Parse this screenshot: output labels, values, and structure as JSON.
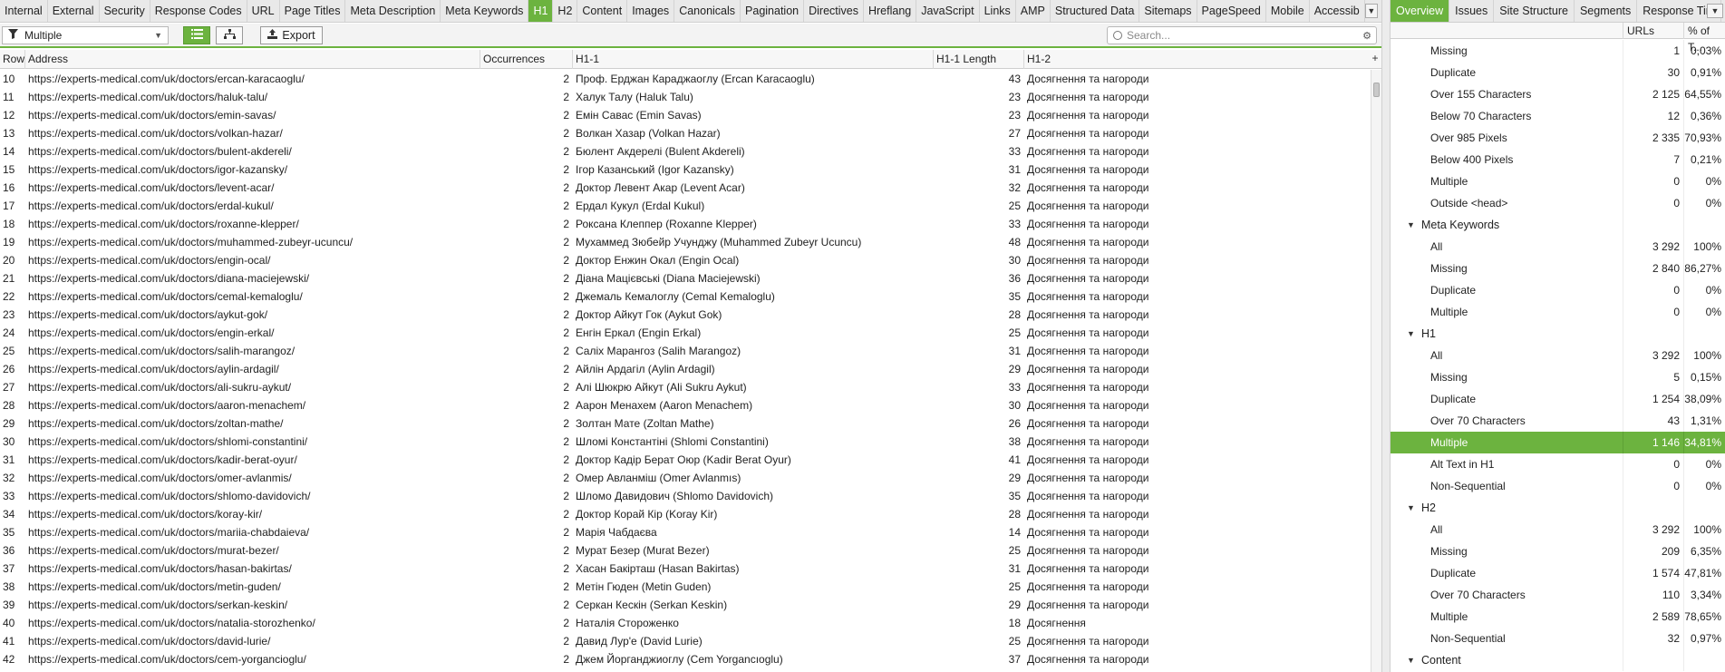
{
  "tabs": [
    "Internal",
    "External",
    "Security",
    "Response Codes",
    "URL",
    "Page Titles",
    "Meta Description",
    "Meta Keywords",
    "H1",
    "H2",
    "Content",
    "Images",
    "Canonicals",
    "Pagination",
    "Directives",
    "Hreflang",
    "JavaScript",
    "Links",
    "AMP",
    "Structured Data",
    "Sitemaps",
    "PageSpeed",
    "Mobile",
    "Accessib"
  ],
  "active_tab": "H1",
  "toolbar": {
    "filter_value": "Multiple",
    "export_label": "Export",
    "search_placeholder": "Search..."
  },
  "columns": {
    "row": "Row",
    "address": "Address",
    "occurrences": "Occurrences",
    "h1_1": "H1-1",
    "h1_1_length": "H1-1 Length",
    "h1_2": "H1-2"
  },
  "rows": [
    {
      "row": "10",
      "address": "https://experts-medical.com/uk/doctors/ercan-karacaoglu/",
      "occ": "2",
      "h1": "Проф. Ерджан Караджаоглу (Ercan Karacaoglu)",
      "len": "43",
      "h12": "Досягнення та нагороди"
    },
    {
      "row": "11",
      "address": "https://experts-medical.com/uk/doctors/haluk-talu/",
      "occ": "2",
      "h1": "Халук Талу (Haluk Talu)",
      "len": "23",
      "h12": "Досягнення та нагороди"
    },
    {
      "row": "12",
      "address": "https://experts-medical.com/uk/doctors/emin-savas/",
      "occ": "2",
      "h1": "Емін Савас (Emin Savas)",
      "len": "23",
      "h12": "Досягнення та нагороди"
    },
    {
      "row": "13",
      "address": "https://experts-medical.com/uk/doctors/volkan-hazar/",
      "occ": "2",
      "h1": "Волкан Хазар (Volkan Hazar)",
      "len": "27",
      "h12": "Досягнення та нагороди"
    },
    {
      "row": "14",
      "address": "https://experts-medical.com/uk/doctors/bulent-akdereli/",
      "occ": "2",
      "h1": "Бюлент Акдерелі (Bulent Akdereli)",
      "len": "33",
      "h12": "Досягнення та нагороди"
    },
    {
      "row": "15",
      "address": "https://experts-medical.com/uk/doctors/igor-kazansky/",
      "occ": "2",
      "h1": "Ігор Казанський (Igor Kazansky)",
      "len": "31",
      "h12": "Досягнення та нагороди"
    },
    {
      "row": "16",
      "address": "https://experts-medical.com/uk/doctors/levent-acar/",
      "occ": "2",
      "h1": "Доктор Левент Акар (Levent Acar)",
      "len": "32",
      "h12": "Досягнення та нагороди"
    },
    {
      "row": "17",
      "address": "https://experts-medical.com/uk/doctors/erdal-kukul/",
      "occ": "2",
      "h1": "Ердал Кукул (Erdal Kukul)",
      "len": "25",
      "h12": "Досягнення та нагороди"
    },
    {
      "row": "18",
      "address": "https://experts-medical.com/uk/doctors/roxanne-klepper/",
      "occ": "2",
      "h1": "Роксана Клеппер (Roxanne Klepper)",
      "len": "33",
      "h12": "Досягнення та нагороди"
    },
    {
      "row": "19",
      "address": "https://experts-medical.com/uk/doctors/muhammed-zubeyr-ucuncu/",
      "occ": "2",
      "h1": "Мухаммед Зюбейр Учунджу (Muhammed Zubeyr Ucuncu)",
      "len": "48",
      "h12": "Досягнення та нагороди"
    },
    {
      "row": "20",
      "address": "https://experts-medical.com/uk/doctors/engin-ocal/",
      "occ": "2",
      "h1": "Доктор Енжин Окал (Engin Ocal)",
      "len": "30",
      "h12": "Досягнення та нагороди"
    },
    {
      "row": "21",
      "address": "https://experts-medical.com/uk/doctors/diana-maciejewski/",
      "occ": "2",
      "h1": "Діана Мацієвські (Diana Maciejewski)",
      "len": "36",
      "h12": "Досягнення та нагороди"
    },
    {
      "row": "22",
      "address": "https://experts-medical.com/uk/doctors/cemal-kemaloglu/",
      "occ": "2",
      "h1": "Джемаль Кемалоглу (Cemal Kemaloglu)",
      "len": "35",
      "h12": "Досягнення та нагороди"
    },
    {
      "row": "23",
      "address": "https://experts-medical.com/uk/doctors/aykut-gok/",
      "occ": "2",
      "h1": "Доктор Айкут Гок (Aykut Gok)",
      "len": "28",
      "h12": "Досягнення та нагороди"
    },
    {
      "row": "24",
      "address": "https://experts-medical.com/uk/doctors/engin-erkal/",
      "occ": "2",
      "h1": "Енгін Еркал (Engin Erkal)",
      "len": "25",
      "h12": "Досягнення та нагороди"
    },
    {
      "row": "25",
      "address": "https://experts-medical.com/uk/doctors/salih-marangoz/",
      "occ": "2",
      "h1": "Саліх Марангоз (Salih Marangoz)",
      "len": "31",
      "h12": "Досягнення та нагороди"
    },
    {
      "row": "26",
      "address": "https://experts-medical.com/uk/doctors/aylin-ardagil/",
      "occ": "2",
      "h1": "Айлін Ардагіл (Aylin Ardagil)",
      "len": "29",
      "h12": "Досягнення та нагороди"
    },
    {
      "row": "27",
      "address": "https://experts-medical.com/uk/doctors/ali-sukru-aykut/",
      "occ": "2",
      "h1": "Алі Шюкрю Айкут (Ali Sukru Aykut)",
      "len": "33",
      "h12": "Досягнення та нагороди"
    },
    {
      "row": "28",
      "address": "https://experts-medical.com/uk/doctors/aaron-menachem/",
      "occ": "2",
      "h1": "Аарон Менахем (Aaron Menachem)",
      "len": "30",
      "h12": "Досягнення та нагороди"
    },
    {
      "row": "29",
      "address": "https://experts-medical.com/uk/doctors/zoltan-mathe/",
      "occ": "2",
      "h1": "Золтан Мате (Zoltan Mathe)",
      "len": "26",
      "h12": "Досягнення та нагороди"
    },
    {
      "row": "30",
      "address": "https://experts-medical.com/uk/doctors/shlomi-constantini/",
      "occ": "2",
      "h1": "Шломі Константіні (Shlomi Constantini)",
      "len": "38",
      "h12": "Досягнення та нагороди"
    },
    {
      "row": "31",
      "address": "https://experts-medical.com/uk/doctors/kadir-berat-oyur/",
      "occ": "2",
      "h1": "Доктор Кадір Берат Оюр (Kadir Berat Oyur)",
      "len": "41",
      "h12": "Досягнення та нагороди"
    },
    {
      "row": "32",
      "address": "https://experts-medical.com/uk/doctors/omer-avlanmis/",
      "occ": "2",
      "h1": "Омер Авланміш (Omer Avlanmıs)",
      "len": "29",
      "h12": "Досягнення та нагороди"
    },
    {
      "row": "33",
      "address": "https://experts-medical.com/uk/doctors/shlomo-davidovich/",
      "occ": "2",
      "h1": "Шломо Давидович (Shlomo Davidovich)",
      "len": "35",
      "h12": "Досягнення та нагороди"
    },
    {
      "row": "34",
      "address": "https://experts-medical.com/uk/doctors/koray-kir/",
      "occ": "2",
      "h1": "Доктор Корай Кір (Koray Kir)",
      "len": "28",
      "h12": "Досягнення та нагороди"
    },
    {
      "row": "35",
      "address": "https://experts-medical.com/uk/doctors/mariia-chabdaieva/",
      "occ": "2",
      "h1": "Марія Чабдаєва",
      "len": "14",
      "h12": "Досягнення та нагороди"
    },
    {
      "row": "36",
      "address": "https://experts-medical.com/uk/doctors/murat-bezer/",
      "occ": "2",
      "h1": "Мурат Безер (Murat Bezer)",
      "len": "25",
      "h12": "Досягнення та нагороди"
    },
    {
      "row": "37",
      "address": "https://experts-medical.com/uk/doctors/hasan-bakirtas/",
      "occ": "2",
      "h1": "Хасан Бакірташ (Hasan Bakirtas)",
      "len": "31",
      "h12": "Досягнення та нагороди"
    },
    {
      "row": "38",
      "address": "https://experts-medical.com/uk/doctors/metin-guden/",
      "occ": "2",
      "h1": "Метін Гюден (Metin Guden)",
      "len": "25",
      "h12": "Досягнення та нагороди"
    },
    {
      "row": "39",
      "address": "https://experts-medical.com/uk/doctors/serkan-keskin/",
      "occ": "2",
      "h1": "Серкан Кескін (Serkan Keskin)",
      "len": "29",
      "h12": "Досягнення та нагороди"
    },
    {
      "row": "40",
      "address": "https://experts-medical.com/uk/doctors/natalia-storozhenko/",
      "occ": "2",
      "h1": "Наталія Стороженко",
      "len": "18",
      "h12": "Досягнення"
    },
    {
      "row": "41",
      "address": "https://experts-medical.com/uk/doctors/david-lurie/",
      "occ": "2",
      "h1": "Давид Лур'е (David Lurie)",
      "len": "25",
      "h12": "Досягнення та нагороди"
    },
    {
      "row": "42",
      "address": "https://experts-medical.com/uk/doctors/cem-yorgancioglu/",
      "occ": "2",
      "h1": "Джем Йорганджиоглу (Cem Yorgancıoglu)",
      "len": "37",
      "h12": "Досягнення та нагороди"
    }
  ],
  "right_tabs": [
    "Overview",
    "Issues",
    "Site Structure",
    "Segments",
    "Response Tim"
  ],
  "right_active_tab": "Overview",
  "right_columns": {
    "urls": "URLs",
    "pct": "% of T..."
  },
  "overview_rows": [
    {
      "type": "item",
      "label": "Missing",
      "urls": "1",
      "pct": "0,03%"
    },
    {
      "type": "item",
      "label": "Duplicate",
      "urls": "30",
      "pct": "0,91%"
    },
    {
      "type": "item",
      "label": "Over 155 Characters",
      "urls": "2 125",
      "pct": "64,55%"
    },
    {
      "type": "item",
      "label": "Below 70 Characters",
      "urls": "12",
      "pct": "0,36%"
    },
    {
      "type": "item",
      "label": "Over 985 Pixels",
      "urls": "2 335",
      "pct": "70,93%"
    },
    {
      "type": "item",
      "label": "Below 400 Pixels",
      "urls": "7",
      "pct": "0,21%"
    },
    {
      "type": "item",
      "label": "Multiple",
      "urls": "0",
      "pct": "0%"
    },
    {
      "type": "item",
      "label": "Outside <head>",
      "urls": "0",
      "pct": "0%"
    },
    {
      "type": "section",
      "label": "Meta Keywords",
      "urls": "",
      "pct": ""
    },
    {
      "type": "item",
      "label": "All",
      "urls": "3 292",
      "pct": "100%"
    },
    {
      "type": "item",
      "label": "Missing",
      "urls": "2 840",
      "pct": "86,27%"
    },
    {
      "type": "item",
      "label": "Duplicate",
      "urls": "0",
      "pct": "0%"
    },
    {
      "type": "item",
      "label": "Multiple",
      "urls": "0",
      "pct": "0%"
    },
    {
      "type": "section",
      "label": "H1",
      "urls": "",
      "pct": ""
    },
    {
      "type": "item",
      "label": "All",
      "urls": "3 292",
      "pct": "100%"
    },
    {
      "type": "item",
      "label": "Missing",
      "urls": "5",
      "pct": "0,15%"
    },
    {
      "type": "item",
      "label": "Duplicate",
      "urls": "1 254",
      "pct": "38,09%"
    },
    {
      "type": "item",
      "label": "Over 70 Characters",
      "urls": "43",
      "pct": "1,31%"
    },
    {
      "type": "item",
      "label": "Multiple",
      "urls": "1 146",
      "pct": "34,81%",
      "selected": true
    },
    {
      "type": "item",
      "label": "Alt Text in H1",
      "urls": "0",
      "pct": "0%"
    },
    {
      "type": "item",
      "label": "Non-Sequential",
      "urls": "0",
      "pct": "0%"
    },
    {
      "type": "section",
      "label": "H2",
      "urls": "",
      "pct": ""
    },
    {
      "type": "item",
      "label": "All",
      "urls": "3 292",
      "pct": "100%"
    },
    {
      "type": "item",
      "label": "Missing",
      "urls": "209",
      "pct": "6,35%"
    },
    {
      "type": "item",
      "label": "Duplicate",
      "urls": "1 574",
      "pct": "47,81%"
    },
    {
      "type": "item",
      "label": "Over 70 Characters",
      "urls": "110",
      "pct": "3,34%"
    },
    {
      "type": "item",
      "label": "Multiple",
      "urls": "2 589",
      "pct": "78,65%"
    },
    {
      "type": "item",
      "label": "Non-Sequential",
      "urls": "32",
      "pct": "0,97%"
    },
    {
      "type": "section",
      "label": "Content",
      "urls": "",
      "pct": ""
    }
  ],
  "icons": {
    "filter": "funnel-icon",
    "list_view": "list-view-icon",
    "tree_view": "tree-view-icon",
    "export": "export-icon",
    "search": "search-icon",
    "search_options": "search-options-icon",
    "add_column": "add-column-icon",
    "expand": "expand-triangle-icon",
    "tabs_overflow": "tabs-overflow-icon"
  },
  "colors": {
    "accent": "#6cb33f",
    "tab_bar": "#e9e9e9"
  }
}
